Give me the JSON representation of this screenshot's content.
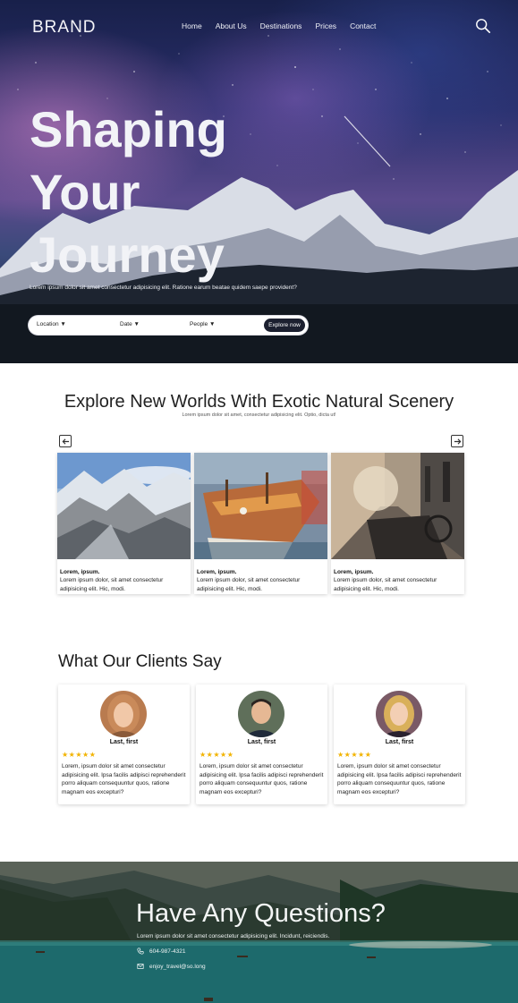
{
  "nav": {
    "brand": "BRAND",
    "links": [
      "Home",
      "About Us",
      "Destinations",
      "Prices",
      "Contact"
    ],
    "search_icon": "search-icon"
  },
  "hero": {
    "title_lines": [
      "Shaping",
      "Your",
      "Journey"
    ],
    "subtitle": "Lorem ipsum dolor sit amet consectetur adipisicing elit. Ratione earum beatae quidem saepe provident?",
    "booking": {
      "location": "Location ▼",
      "date": "Date ▼",
      "people": "People ▼",
      "button": "Explore now"
    }
  },
  "explore": {
    "title": "Explore New Worlds With Exotic Natural Scenery",
    "subtitle": "Lorem ipsum dolor sit amet, consectetur adipisicing elit. Optio, dicta ut!",
    "prev_icon": "arrow-left-icon",
    "next_icon": "arrow-right-icon",
    "cards": [
      {
        "title": "Lorem, ipsum.",
        "body": "Lorem ipsum dolor, sit amet consectetur adipisicing elit. Hic, modi."
      },
      {
        "title": "Lorem, ipsum.",
        "body": "Lorem ipsum dolor, sit amet consectetur adipisicing elit. Hic, modi."
      },
      {
        "title": "Lorem, ipsum.",
        "body": "Lorem ipsum dolor, sit amet consectetur adipisicing elit. Hic, modi."
      }
    ]
  },
  "clients": {
    "title": "What Our Clients Say",
    "testimonials": [
      {
        "name": "Last, first",
        "stars": "★★★★★",
        "rating": 5,
        "quote": "Lorem, ipsum dolor sit amet consectetur adipisicing elit. Ipsa facilis adipisci reprehenderit porro aliquam consequuntur quos, ratione magnam eos excepturi?"
      },
      {
        "name": "Last, first",
        "stars": "★★★★★",
        "rating": 5,
        "quote": "Lorem, ipsum dolor sit amet consectetur adipisicing elit. Ipsa facilis adipisci reprehenderit porro aliquam consequuntur quos, ratione magnam eos excepturi?"
      },
      {
        "name": "Last, first",
        "stars": "★★★★★",
        "rating": 5,
        "quote": "Lorem, ipsum dolor sit amet consectetur adipisicing elit. Ipsa facilis adipisci reprehenderit porro aliquam consequuntur quos, ratione magnam eos excepturi?"
      }
    ]
  },
  "footer": {
    "title": "Have Any Questions?",
    "subtitle": "Lorem ipsum dolor sit amet consectetur adipisicing elit. Incidunt, reiciendis.",
    "phone": "604-987-4321",
    "email": "enjoy_travel@so.long",
    "phone_icon": "phone-icon",
    "email_icon": "mail-icon"
  },
  "colors": {
    "button_dark": "#1c2030",
    "star": "#f2b300"
  }
}
